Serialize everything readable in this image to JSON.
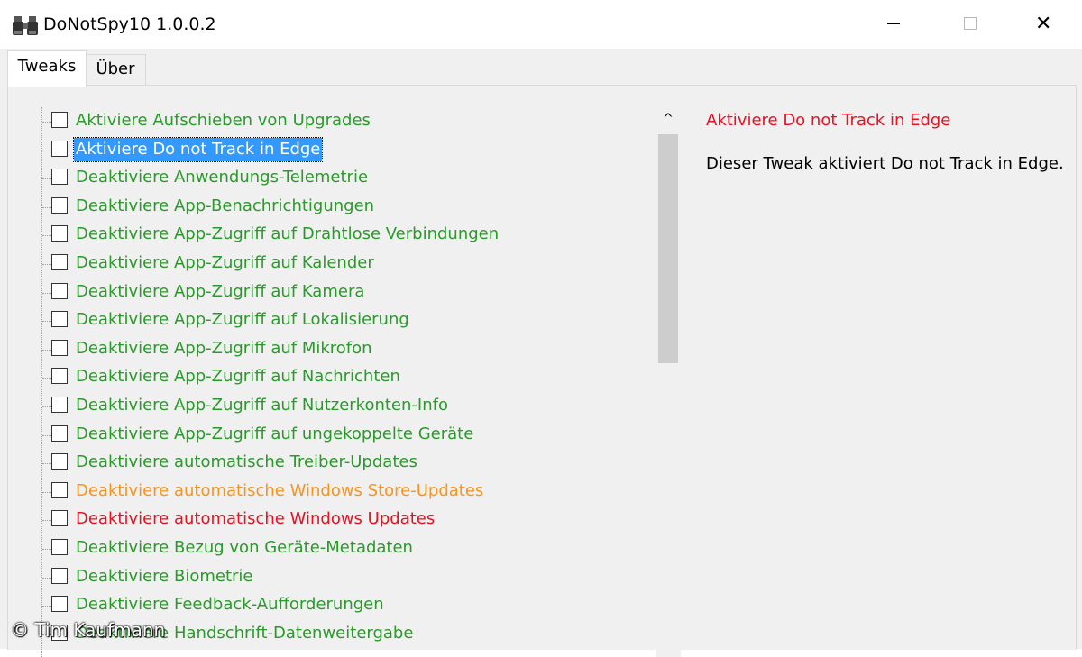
{
  "window": {
    "title": "DoNotSpy10 1.0.0.2",
    "icon": "binoculars-icon",
    "close_glyph": "✕"
  },
  "tabs": [
    {
      "label": "Tweaks",
      "active": true
    },
    {
      "label": "Über",
      "active": false
    }
  ],
  "colors": {
    "green": "#2a9a2a",
    "orange": "#f7941d",
    "red": "#e81123",
    "selected_bg": "#3399ff"
  },
  "tweaks": [
    {
      "label": "Aktiviere Aufschieben von Upgrades",
      "color": "green",
      "checked": false,
      "selected": false
    },
    {
      "label": "Aktiviere Do not Track in Edge",
      "color": "green",
      "checked": false,
      "selected": true
    },
    {
      "label": "Deaktiviere Anwendungs-Telemetrie",
      "color": "green",
      "checked": false,
      "selected": false
    },
    {
      "label": "Deaktiviere App-Benachrichtigungen",
      "color": "green",
      "checked": false,
      "selected": false
    },
    {
      "label": "Deaktiviere App-Zugriff auf Drahtlose Verbindungen",
      "color": "green",
      "checked": false,
      "selected": false
    },
    {
      "label": "Deaktiviere App-Zugriff auf Kalender",
      "color": "green",
      "checked": false,
      "selected": false
    },
    {
      "label": "Deaktiviere App-Zugriff auf Kamera",
      "color": "green",
      "checked": false,
      "selected": false
    },
    {
      "label": "Deaktiviere App-Zugriff auf Lokalisierung",
      "color": "green",
      "checked": false,
      "selected": false
    },
    {
      "label": "Deaktiviere App-Zugriff auf Mikrofon",
      "color": "green",
      "checked": false,
      "selected": false
    },
    {
      "label": "Deaktiviere App-Zugriff auf Nachrichten",
      "color": "green",
      "checked": false,
      "selected": false
    },
    {
      "label": "Deaktiviere App-Zugriff auf Nutzerkonten-Info",
      "color": "green",
      "checked": false,
      "selected": false
    },
    {
      "label": "Deaktiviere App-Zugriff auf ungekoppelte Geräte",
      "color": "green",
      "checked": false,
      "selected": false
    },
    {
      "label": "Deaktiviere automatische Treiber-Updates",
      "color": "green",
      "checked": false,
      "selected": false
    },
    {
      "label": "Deaktiviere automatische Windows Store-Updates",
      "color": "orange",
      "checked": false,
      "selected": false
    },
    {
      "label": "Deaktiviere automatische Windows Updates",
      "color": "red",
      "checked": false,
      "selected": false
    },
    {
      "label": "Deaktiviere Bezug von Geräte-Metadaten",
      "color": "green",
      "checked": false,
      "selected": false
    },
    {
      "label": "Deaktiviere Biometrie",
      "color": "green",
      "checked": false,
      "selected": false
    },
    {
      "label": "Deaktiviere Feedback-Aufforderungen",
      "color": "green",
      "checked": false,
      "selected": false
    },
    {
      "label": "Deaktiviere Handschrift-Datenweitergabe",
      "color": "green",
      "checked": false,
      "selected": false
    }
  ],
  "detail": {
    "title": "Aktiviere Do not Track in Edge",
    "description": "Dieser Tweak aktiviert Do not Track in Edge."
  },
  "scrollbar": {
    "up_arrow": "^"
  },
  "watermark": "© Tim Kaufmann"
}
